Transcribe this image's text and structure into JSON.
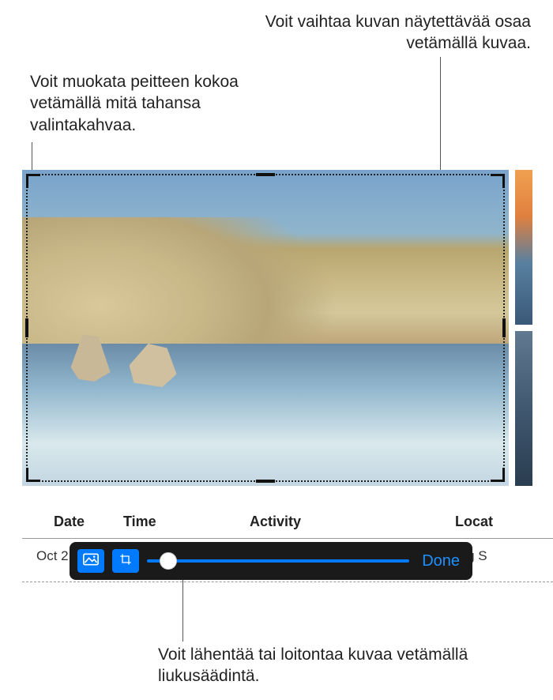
{
  "callouts": {
    "drag_image": "Voit vaihtaa kuvan näytettävää osaa vetämällä kuvaa.",
    "resize_mask": "Voit muokata peitteen kokoa vetämällä mitä tahansa valintakahvaa.",
    "zoom_slider": "Voit lähentää tai loitontaa kuvaa vetämällä liukusäädintä."
  },
  "table": {
    "headers": {
      "date": "Date",
      "time": "Time",
      "activity": "Activity",
      "location": "Locat"
    },
    "row": {
      "date": "Oct 2",
      "time": "",
      "activity": "",
      "location": "Big S"
    }
  },
  "toolbar": {
    "done_label": "Done",
    "slider_value": 8,
    "icons": {
      "image": "image-icon",
      "crop": "crop-icon"
    }
  },
  "colors": {
    "accent": "#007aff",
    "toolbar_bg": "#1a1a1a"
  }
}
